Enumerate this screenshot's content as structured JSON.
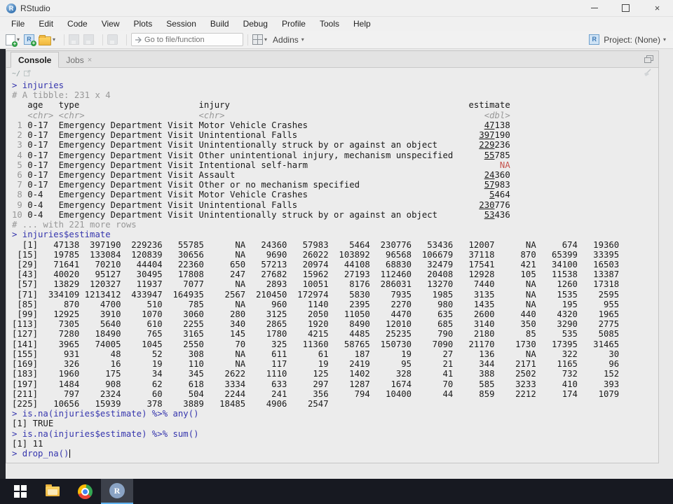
{
  "window": {
    "title": "RStudio"
  },
  "menu": [
    "File",
    "Edit",
    "Code",
    "View",
    "Plots",
    "Session",
    "Build",
    "Debug",
    "Profile",
    "Tools",
    "Help"
  ],
  "toolbar": {
    "goto_placeholder": "Go to file/function",
    "addins_label": "Addins",
    "project_label": "Project: (None)"
  },
  "console_pane": {
    "tabs": [
      {
        "label": "Console",
        "active": true,
        "closable": false
      },
      {
        "label": "Jobs",
        "active": false,
        "closable": true
      }
    ],
    "cwd": "~/",
    "blocks": [
      {
        "kind": "cmd",
        "text": "injuries"
      },
      {
        "kind": "meta",
        "text": "# A tibble: 231 x 4"
      },
      {
        "kind": "tibble_header",
        "columns": [
          "age",
          "type",
          "injury",
          "estimate"
        ],
        "col_types": [
          "<chr>",
          "<chr>",
          "<chr>",
          "<dbl>"
        ]
      },
      {
        "kind": "tibble_rows",
        "rows": [
          [
            1,
            "0-17",
            "Emergency Department Visit",
            "Motor Vehicle Crashes",
            "47138"
          ],
          [
            2,
            "0-17",
            "Emergency Department Visit",
            "Unintentional Falls",
            "397190"
          ],
          [
            3,
            "0-17",
            "Emergency Department Visit",
            "Unintentionally struck by or against an object",
            "229236"
          ],
          [
            4,
            "0-17",
            "Emergency Department Visit",
            "Other unintentional injury, mechanism unspecified",
            "55785"
          ],
          [
            5,
            "0-17",
            "Emergency Department Visit",
            "Intentional self-harm",
            "NA"
          ],
          [
            6,
            "0-17",
            "Emergency Department Visit",
            "Assault",
            "24360"
          ],
          [
            7,
            "0-17",
            "Emergency Department Visit",
            "Other or no mechanism specified",
            "57983"
          ],
          [
            8,
            "0-4",
            "Emergency Department Visit",
            "Motor Vehicle Crashes",
            "5464"
          ],
          [
            9,
            "0-4",
            "Emergency Department Visit",
            "Unintentional Falls",
            "230776"
          ],
          [
            10,
            "0-4",
            "Emergency Department Visit",
            "Unintentionally struck by or against an object",
            "53436"
          ]
        ]
      },
      {
        "kind": "meta",
        "text": "# ... with 221 more rows"
      },
      {
        "kind": "cmd",
        "text": "injuries$estimate"
      },
      {
        "kind": "vector",
        "index_width": 5,
        "field_width": 7,
        "rows": [
          {
            "start": 1,
            "values": [
              "47138",
              "397190",
              "229236",
              "55785",
              "NA",
              "24360",
              "57983",
              "5464",
              "230776",
              "53436",
              "12007",
              "NA",
              "674",
              "19360"
            ]
          },
          {
            "start": 15,
            "values": [
              "19785",
              "133084",
              "120839",
              "30656",
              "NA",
              "9690",
              "26022",
              "103892",
              "96568",
              "106679",
              "37118",
              "870",
              "65399",
              "33395"
            ]
          },
          {
            "start": 29,
            "values": [
              "71641",
              "70210",
              "44404",
              "22360",
              "650",
              "57213",
              "20974",
              "44108",
              "68830",
              "32479",
              "17541",
              "421",
              "34100",
              "16503"
            ]
          },
          {
            "start": 43,
            "values": [
              "40020",
              "95127",
              "30495",
              "17808",
              "247",
              "27682",
              "15962",
              "27193",
              "112460",
              "20408",
              "12928",
              "105",
              "11538",
              "13387"
            ]
          },
          {
            "start": 57,
            "values": [
              "13829",
              "120327",
              "11937",
              "7077",
              "NA",
              "2893",
              "10051",
              "8176",
              "286031",
              "13270",
              "7440",
              "NA",
              "1260",
              "17318"
            ]
          },
          {
            "start": 71,
            "values": [
              "334109",
              "1213412",
              "433947",
              "164935",
              "2567",
              "210450",
              "172974",
              "5830",
              "7935",
              "1985",
              "3135",
              "NA",
              "1535",
              "2595"
            ]
          },
          {
            "start": 85,
            "values": [
              "870",
              "4700",
              "510",
              "785",
              "NA",
              "960",
              "1140",
              "2395",
              "2270",
              "980",
              "1435",
              "NA",
              "195",
              "955"
            ]
          },
          {
            "start": 99,
            "values": [
              "12925",
              "3910",
              "1070",
              "3060",
              "280",
              "3125",
              "2050",
              "11050",
              "4470",
              "635",
              "2600",
              "440",
              "4320",
              "1965"
            ]
          },
          {
            "start": 113,
            "values": [
              "7305",
              "5640",
              "610",
              "2255",
              "340",
              "2865",
              "1920",
              "8490",
              "12010",
              "685",
              "3140",
              "350",
              "3290",
              "2775"
            ]
          },
          {
            "start": 127,
            "values": [
              "7280",
              "18490",
              "765",
              "3165",
              "145",
              "1780",
              "4215",
              "4485",
              "25235",
              "790",
              "2180",
              "85",
              "535",
              "5085"
            ]
          },
          {
            "start": 141,
            "values": [
              "3965",
              "74005",
              "1045",
              "2550",
              "70",
              "325",
              "11360",
              "58765",
              "150730",
              "7090",
              "21170",
              "1730",
              "17395",
              "31465"
            ]
          },
          {
            "start": 155,
            "values": [
              "931",
              "48",
              "52",
              "308",
              "NA",
              "611",
              "61",
              "187",
              "19",
              "27",
              "136",
              "NA",
              "322",
              "30"
            ]
          },
          {
            "start": 169,
            "values": [
              "326",
              "16",
              "19",
              "110",
              "NA",
              "117",
              "19",
              "2419",
              "95",
              "21",
              "344",
              "2171",
              "1165",
              "96"
            ]
          },
          {
            "start": 183,
            "values": [
              "1960",
              "175",
              "34",
              "345",
              "2622",
              "1110",
              "125",
              "1402",
              "328",
              "41",
              "388",
              "2502",
              "732",
              "152"
            ]
          },
          {
            "start": 197,
            "values": [
              "1484",
              "908",
              "62",
              "618",
              "3334",
              "633",
              "297",
              "1287",
              "1674",
              "70",
              "585",
              "3233",
              "410",
              "393"
            ]
          },
          {
            "start": 211,
            "values": [
              "797",
              "2324",
              "60",
              "504",
              "2244",
              "241",
              "356",
              "794",
              "10400",
              "44",
              "859",
              "2212",
              "174",
              "1079"
            ]
          },
          {
            "start": 225,
            "values": [
              "10656",
              "15939",
              "378",
              "3889",
              "18485",
              "4906",
              "2547"
            ]
          }
        ]
      },
      {
        "kind": "cmd",
        "text": "is.na(injuries$estimate) %>% any()"
      },
      {
        "kind": "out",
        "text": "[1] TRUE"
      },
      {
        "kind": "cmd",
        "text": "is.na(injuries$estimate) %>% sum()"
      },
      {
        "kind": "out",
        "text": "[1] 11"
      },
      {
        "kind": "cmd",
        "text": "drop_na()",
        "cursor": true
      }
    ]
  },
  "colors": {
    "command_blue": "#3535ad",
    "meta_gray": "#989898",
    "output_black": "#1a1a1a",
    "na_red": "#c5524c",
    "taskbar_accent": "#5fb2ef"
  },
  "taskbar": {
    "items": [
      {
        "name": "start"
      },
      {
        "name": "file-explorer"
      },
      {
        "name": "chrome"
      },
      {
        "name": "rstudio",
        "active": true
      }
    ]
  }
}
